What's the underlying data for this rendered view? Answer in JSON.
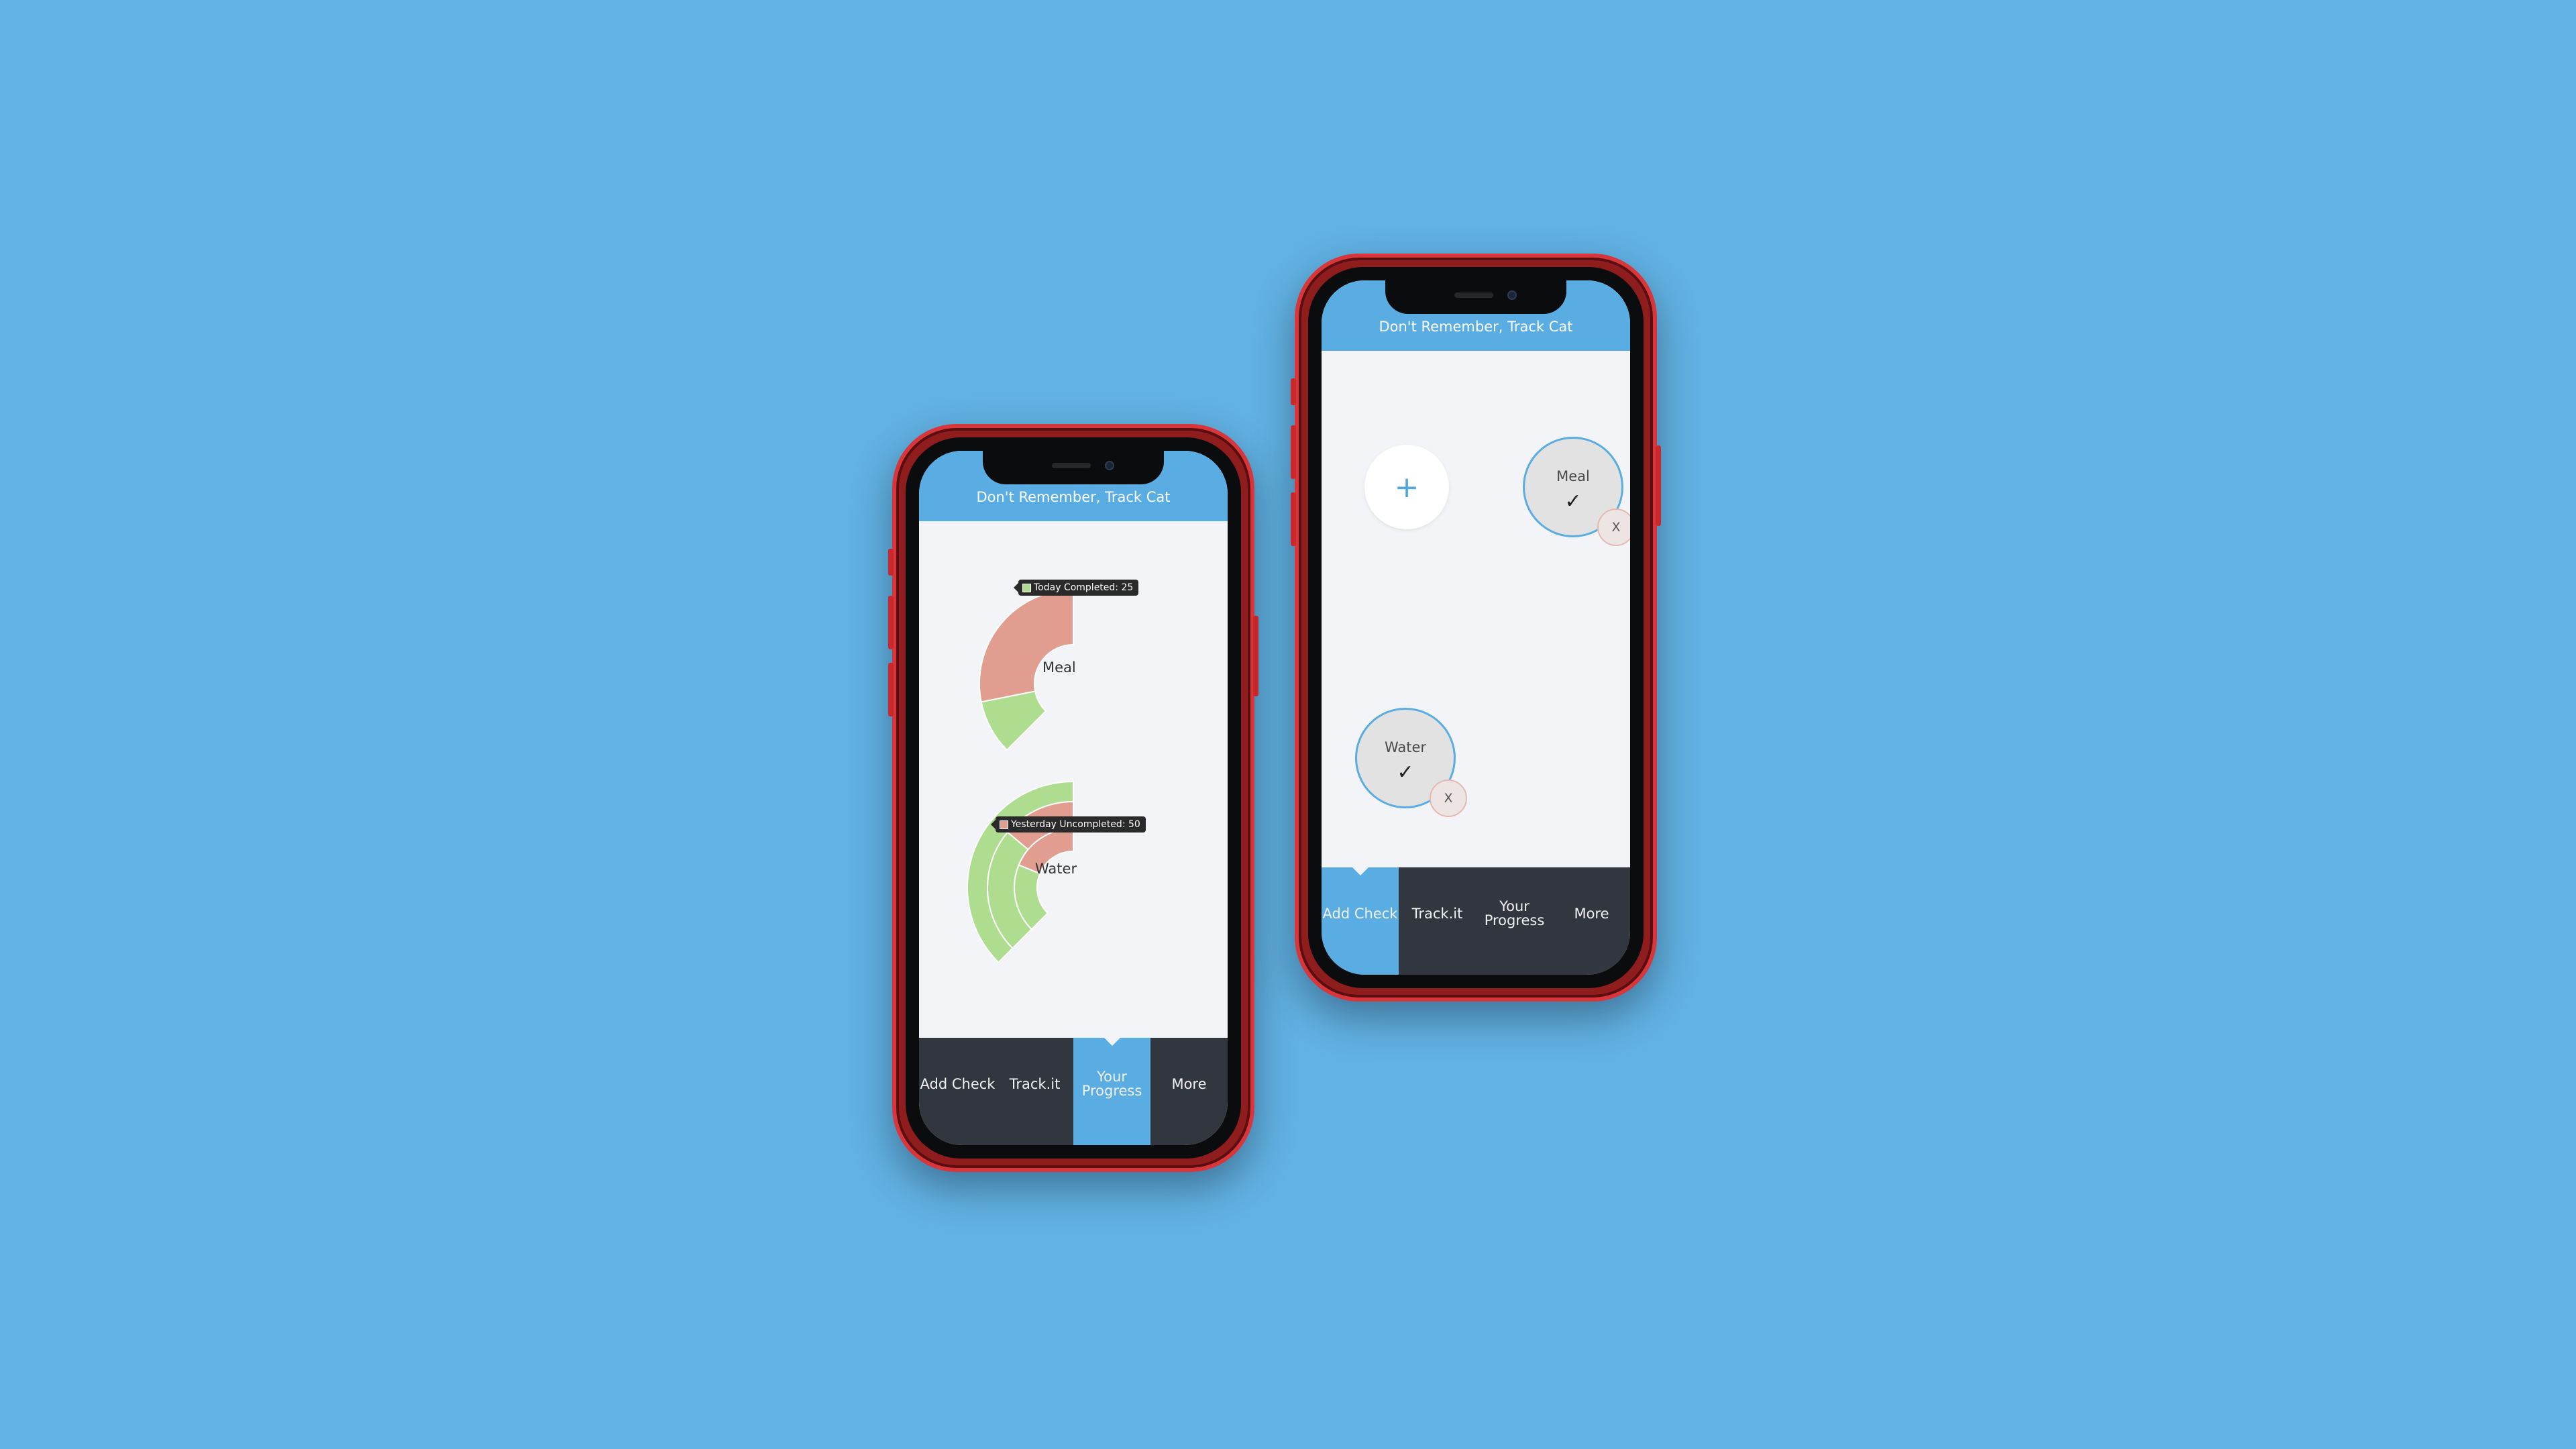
{
  "app": {
    "title": "Don't Remember, Track Cat"
  },
  "tabs": [
    {
      "label": "Add Check"
    },
    {
      "label": "Track.it"
    },
    {
      "label": "Your\nProgress"
    },
    {
      "label": "More"
    }
  ],
  "colors": {
    "background": "#62b2e3",
    "header": "#5aade3",
    "tabbar": "#32373f",
    "completed": "#afdd90",
    "uncompleted": "#e09d90",
    "phone_frame": "#c9282c"
  },
  "progress_screen": {
    "active_tab": "Your Progress",
    "charts": [
      {
        "type": "pie",
        "name": "Meal",
        "label": "Meal",
        "tooltip": "Today Completed: 25",
        "rings": [
          {
            "slices": [
              {
                "status": "completed",
                "value": 25
              },
              {
                "status": "uncompleted",
                "value": 75
              }
            ]
          }
        ]
      },
      {
        "type": "pie",
        "name": "Water",
        "label": "Water",
        "tooltip": "Yesterday Uncompleted: 50",
        "rings": [
          {
            "slices": [
              {
                "status": "completed",
                "value": 100
              }
            ]
          },
          {
            "slices": [
              {
                "status": "completed",
                "value": 63
              },
              {
                "status": "uncompleted",
                "value": 37
              }
            ]
          },
          {
            "slices": [
              {
                "status": "completed",
                "value": 50
              },
              {
                "status": "uncompleted",
                "value": 50
              }
            ]
          }
        ]
      }
    ]
  },
  "add_screen": {
    "active_tab": "Add Check",
    "add_button": {
      "icon": "plus-icon",
      "glyph": "+"
    },
    "checks": [
      {
        "name": "Meal",
        "status_icon": "check-icon",
        "glyph": "✓",
        "remove_label": "X"
      },
      {
        "name": "Water",
        "status_icon": "check-icon",
        "glyph": "✓",
        "remove_label": "X"
      }
    ]
  }
}
